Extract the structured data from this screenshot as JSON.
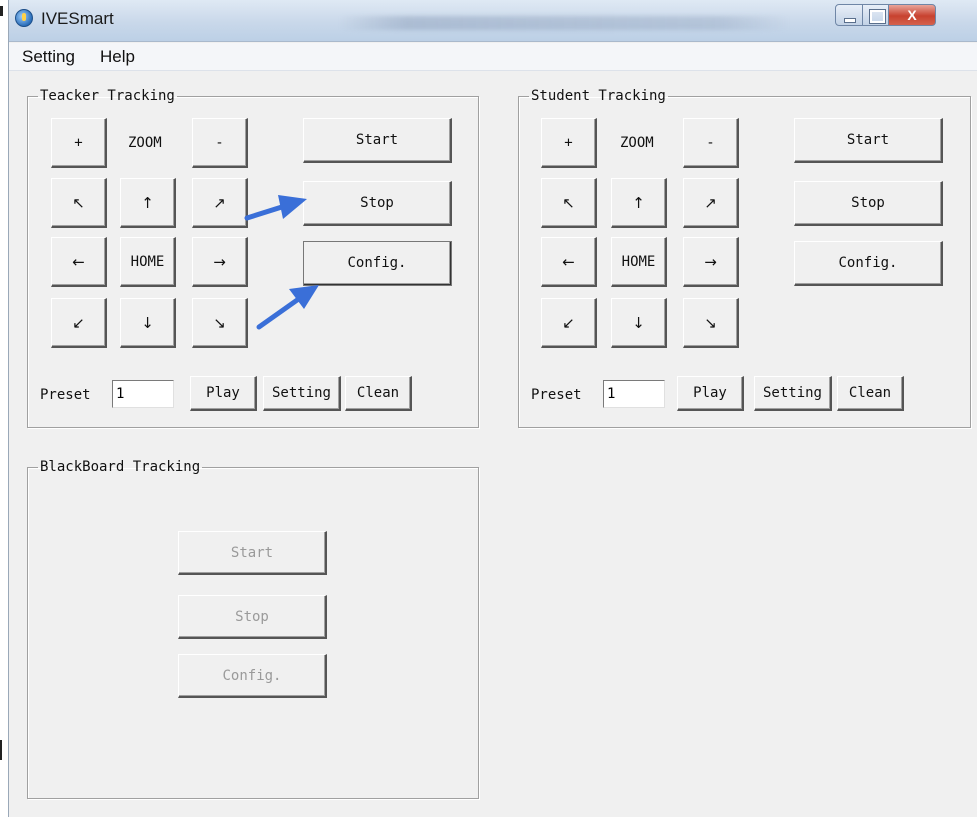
{
  "window": {
    "title": "IVESmart",
    "close_glyph": "X"
  },
  "menu": [
    "Setting",
    "Help"
  ],
  "teacher": {
    "legend": "Teacker Tracking",
    "pad": {
      "plus": "+",
      "zoom": "ZOOM",
      "minus": "-",
      "up_left": "↖",
      "up": "↑",
      "up_right": "↗",
      "left": "←",
      "home": "HOME",
      "right": "→",
      "down_left": "↙",
      "down": "↓",
      "down_right": "↘"
    },
    "start": "Start",
    "stop": "Stop",
    "config": "Config.",
    "preset_label": "Preset",
    "preset_value": "1",
    "play": "Play",
    "setting": "Setting",
    "clean": "Clean"
  },
  "student": {
    "legend": "Student Tracking",
    "pad": {
      "plus": "+",
      "zoom": "ZOOM",
      "minus": "-",
      "up_left": "↖",
      "up": "↑",
      "up_right": "↗",
      "left": "←",
      "home": "HOME",
      "right": "→",
      "down_left": "↙",
      "down": "↓",
      "down_right": "↘"
    },
    "start": "Start",
    "stop": "Stop",
    "config": "Config.",
    "preset_label": "Preset",
    "preset_value": "1",
    "play": "Play",
    "setting": "Setting",
    "clean": "Clean"
  },
  "blackboard": {
    "legend": "BlackBoard Tracking",
    "start": "Start",
    "stop": "Stop",
    "config": "Config."
  },
  "annotation": {
    "arrow_color": "#3a6fd8"
  }
}
